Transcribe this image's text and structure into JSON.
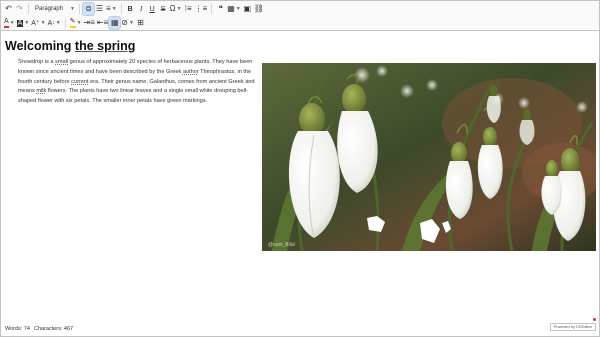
{
  "toolbar": {
    "row1": {
      "undo_icon": "undo-icon",
      "redo_icon": "redo-icon",
      "block_format": "Paragraph",
      "bold": "B",
      "italic": "I",
      "underline": "U",
      "strikethrough": "S",
      "special_char": "Ω"
    },
    "row2": {
      "font_color": "A",
      "bg_color": "A",
      "font_size": "A",
      "highlight_color": "#f6d31b",
      "font_color_value": "#d32f2f"
    }
  },
  "document": {
    "title_part1": "Welcoming ",
    "title_part2": "the spring",
    "para": {
      "t1": "Snowdrop is a ",
      "w1": "small",
      "t2": " genus of approximately 20 species of herbaceous plants. They have been known since ancient times and have been described by the Greek ",
      "w2": "author",
      "t3": " Theophrastus, in the fourth century before ",
      "w3": "current",
      "t4": " era. Their genus name, Galanthus, comes from ancient Greek and means ",
      "w4": "milk",
      "t5": " flowers. The plants have two linear leaves and a single small white drooping bell-shaped flower with six petals. The smaller inner petals have green markings."
    },
    "image_caption_watermark": "@nani_Bilal"
  },
  "status": {
    "words_label": "Words: 74",
    "characters_label": "Characters: 467",
    "powered_by": "Powered by CKEditor"
  },
  "colors": {
    "toolbar_bg": "#fafafa",
    "active_button": "#d0e1f7",
    "border": "#c4c4c4"
  }
}
